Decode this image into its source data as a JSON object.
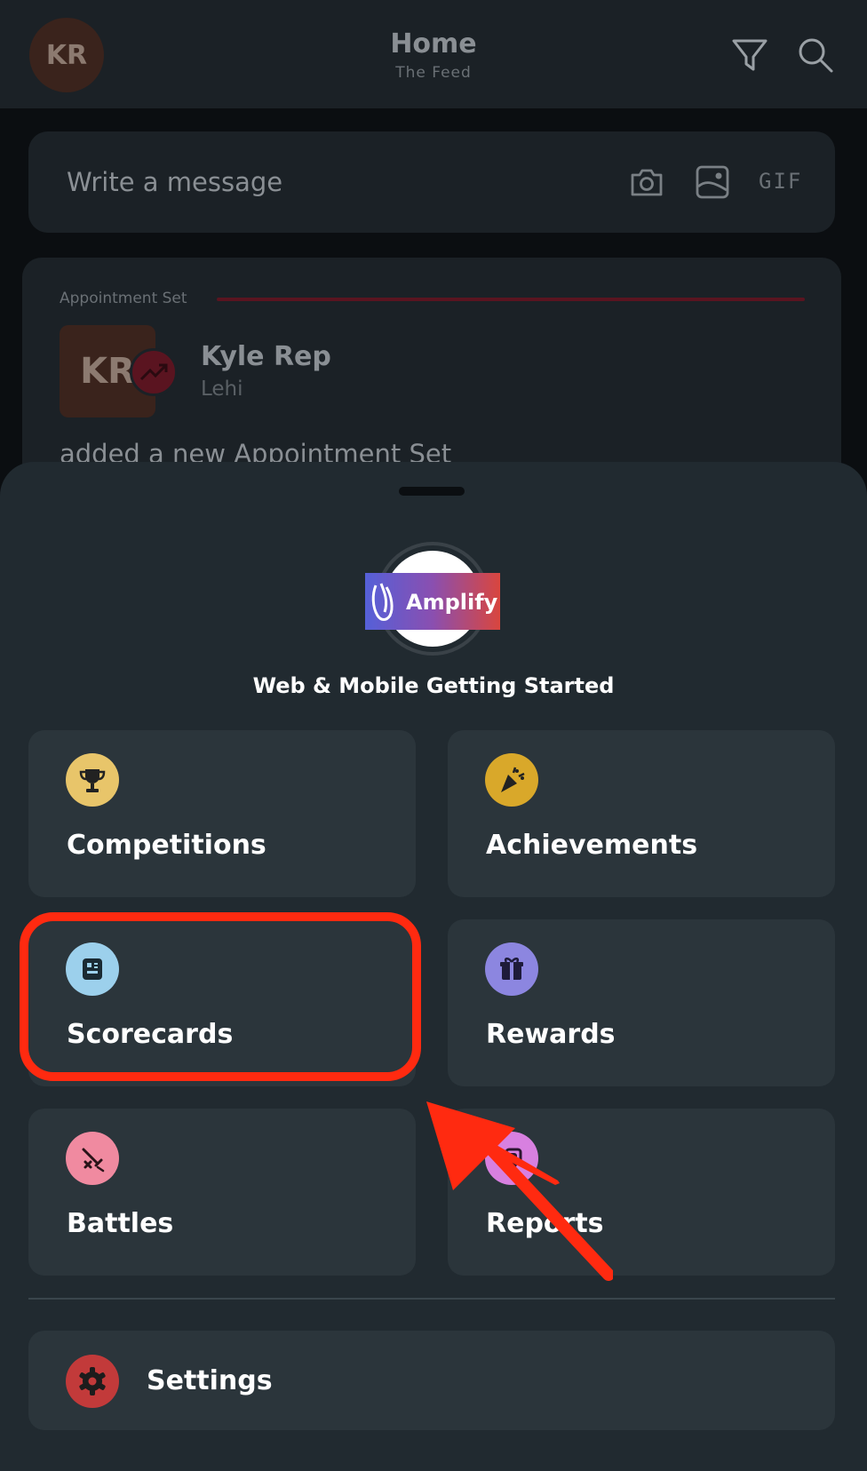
{
  "header": {
    "avatar_initials": "KR",
    "title": "Home",
    "subtitle": "The Feed",
    "icons": [
      "filter-icon",
      "search-icon"
    ]
  },
  "composer": {
    "placeholder": "Write a message",
    "gif_label": "GIF",
    "icons": [
      "camera-icon",
      "image-icon"
    ]
  },
  "feed": {
    "type_label": "Appointment Set",
    "avatar_initials": "KR",
    "user_name": "Kyle Rep",
    "location": "Lehi",
    "action_text": "added a new Appointment Set",
    "accent_color": "#5a1420"
  },
  "sheet": {
    "org_logo_text": "Amplify",
    "org_name": "Web & Mobile Getting Started",
    "tiles": [
      {
        "label": "Competitions",
        "icon": "trophy-icon",
        "color": "#e8c56a"
      },
      {
        "label": "Achievements",
        "icon": "party-popper-icon",
        "color": "#d9a82a"
      },
      {
        "label": "Scorecards",
        "icon": "scorecard-icon",
        "color": "#9cd0ec"
      },
      {
        "label": "Rewards",
        "icon": "gift-icon",
        "color": "#8c86e0"
      },
      {
        "label": "Battles",
        "icon": "crossed-swords-icon",
        "color": "#f08aa0"
      },
      {
        "label": "Reports",
        "icon": "reports-icon",
        "color": "#d880e0"
      }
    ],
    "settings": {
      "label": "Settings",
      "icon": "gear-icon",
      "color": "#c23a3a"
    }
  },
  "annotation": {
    "highlight_target": "Scorecards",
    "color": "#ff2a10"
  }
}
